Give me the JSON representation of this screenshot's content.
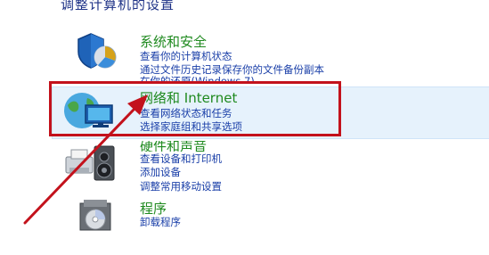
{
  "page": {
    "title": "调整计算机的设置"
  },
  "categories": [
    {
      "title": "系统和安全",
      "links": [
        "查看你的计算机状态",
        "通过文件历史记录保存你的文件备份副本",
        "在你的还原(Windows 7)"
      ]
    },
    {
      "title": "网络和 Internet",
      "links": [
        "查看网络状态和任务",
        "选择家庭组和共享选项"
      ]
    },
    {
      "title": "硬件和声音",
      "links": [
        "查看设备和打印机",
        "添加设备",
        "调整常用移动设置"
      ]
    },
    {
      "title": "程序",
      "links": [
        "卸载程序"
      ]
    }
  ],
  "annotation": {
    "color": "#c3121c"
  }
}
